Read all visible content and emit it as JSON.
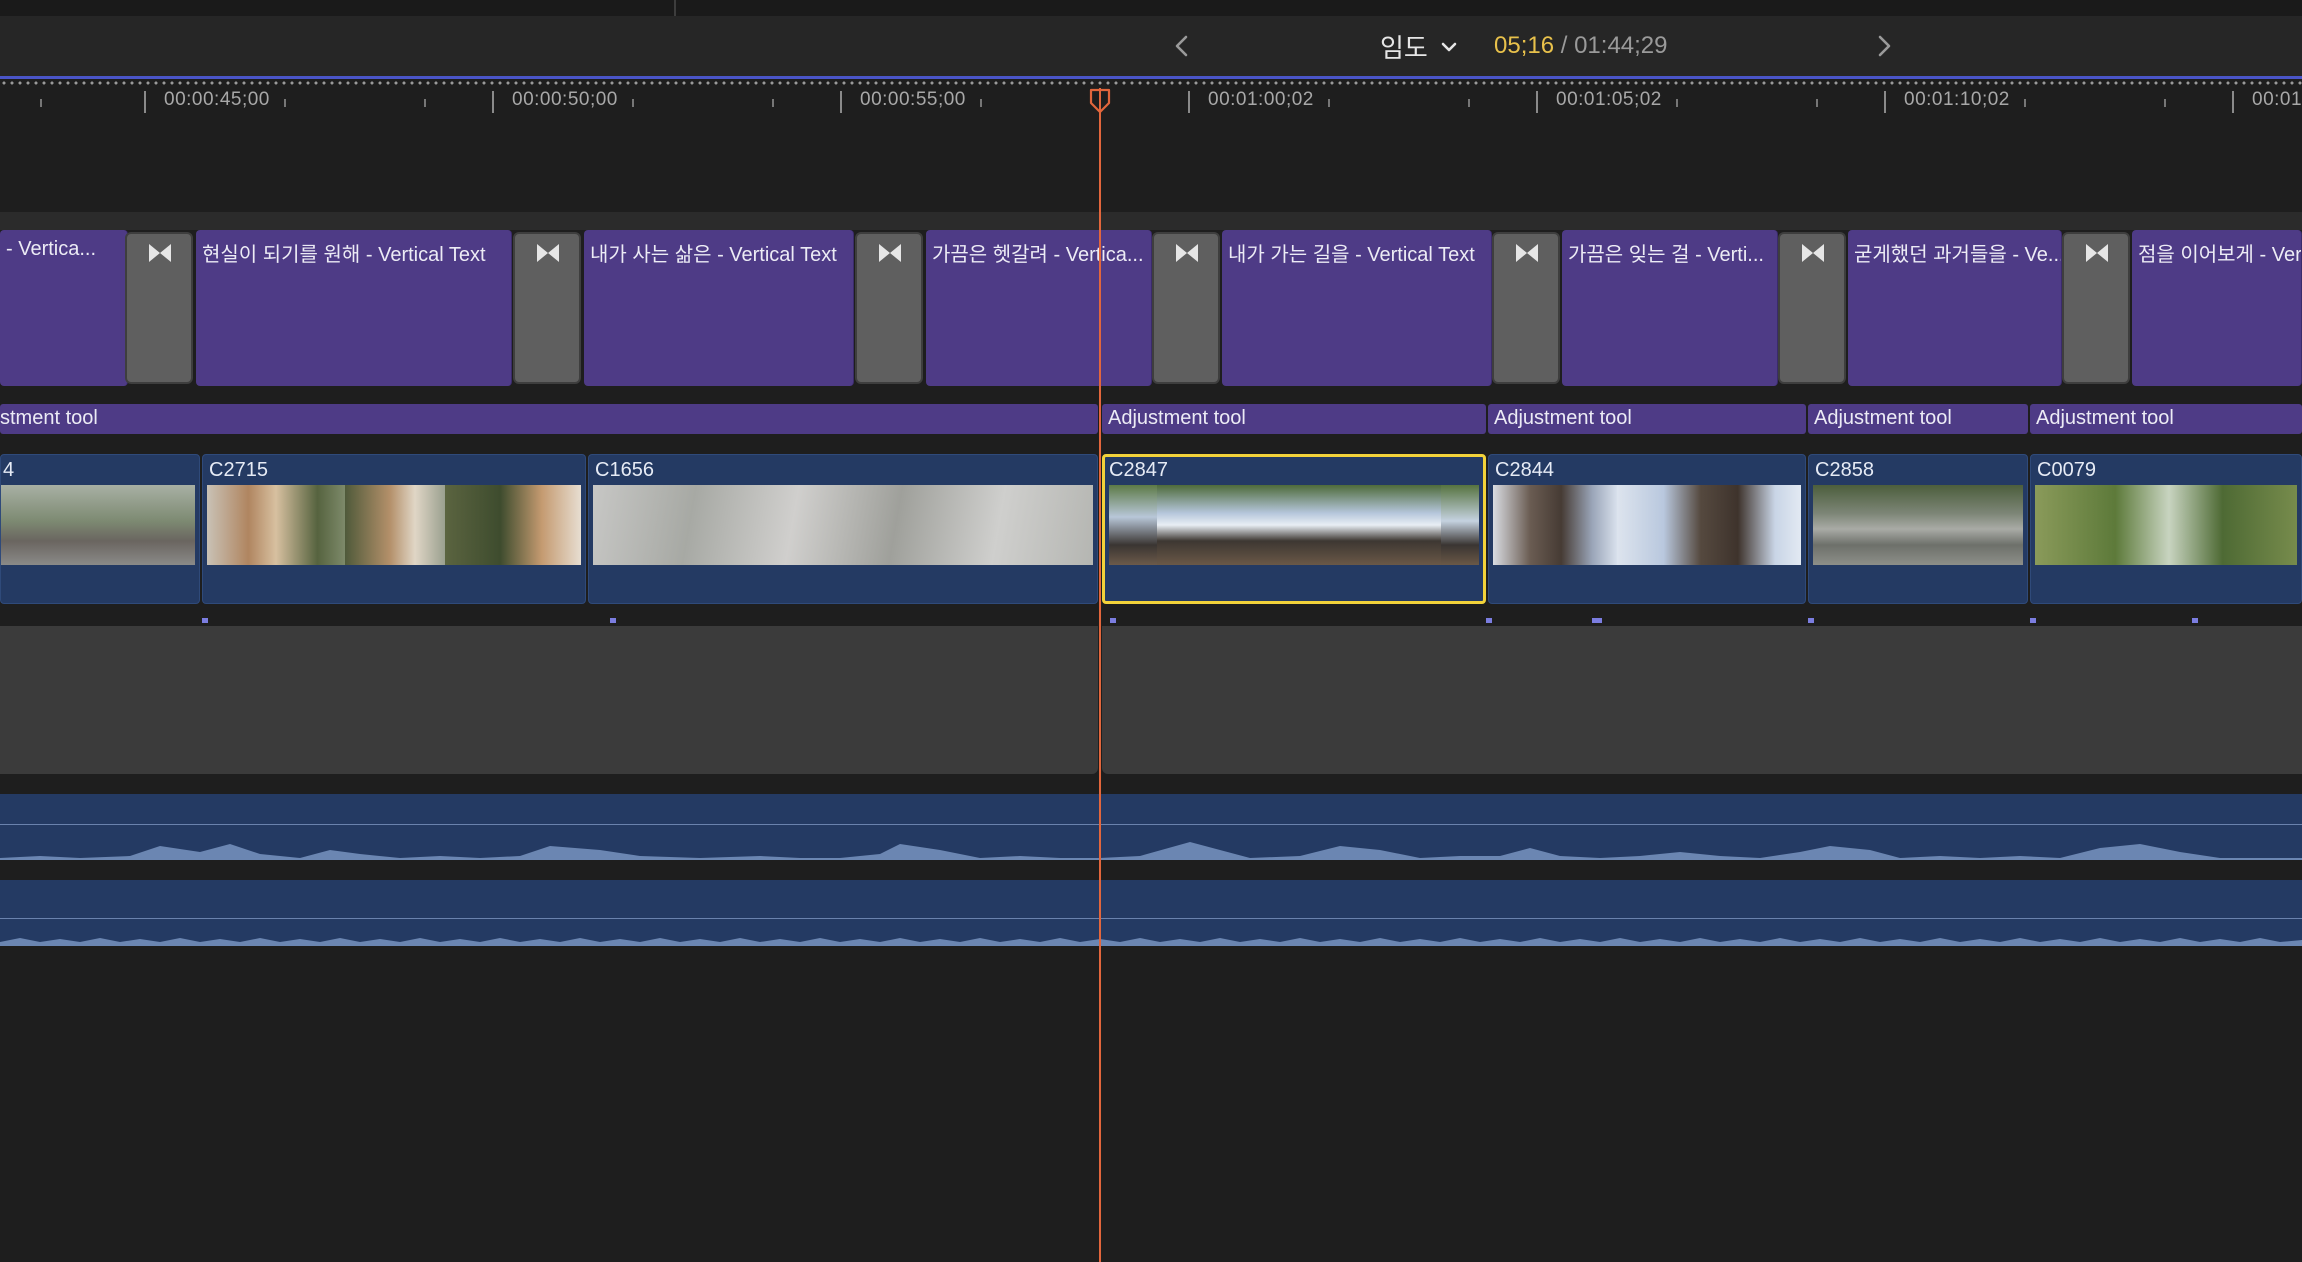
{
  "header": {
    "index_label": "임도",
    "timecode_current": "05;16",
    "timecode_separator": " / ",
    "timecode_total": "01:44;29"
  },
  "ruler": {
    "labels": [
      "00:00:45;00",
      "00:00:50;00",
      "00:00:55;00",
      "00:01:00;02",
      "00:01:05;02",
      "00:01:10;02",
      "00:01:"
    ]
  },
  "titles": [
    "- Vertica...",
    "현실이 되기를 원해  - Vertical Text",
    "내가 사는 삶은  - Vertical Text",
    "가끔은 헷갈려 - Vertica...",
    "내가 가는 길을  - Vertical Text",
    "가끔은 잊는 걸 - Verti...",
    "굳게했던 과거들을  - Ve...",
    "점을 이어보게 - Vertical Text"
  ],
  "adjustments": [
    "stment tool",
    "Adjustment tool",
    "Adjustment tool",
    "Adjustment tool",
    "Adjustment tool"
  ],
  "clips": [
    {
      "name": "4"
    },
    {
      "name": "C2715"
    },
    {
      "name": "C1656"
    },
    {
      "name": "C2847"
    },
    {
      "name": "C2844"
    },
    {
      "name": "C2858"
    },
    {
      "name": "C0079"
    }
  ],
  "colors": {
    "title": "#4e3b86",
    "video": "#243a63",
    "selection": "#f2d23a",
    "playhead": "#e2663c",
    "timecode_current": "#e8c14b"
  },
  "icons": {
    "prev": "chevron-left-icon",
    "next": "chevron-right-icon",
    "dropdown": "chevron-down-icon",
    "transition": "bowtie-transition-icon"
  }
}
